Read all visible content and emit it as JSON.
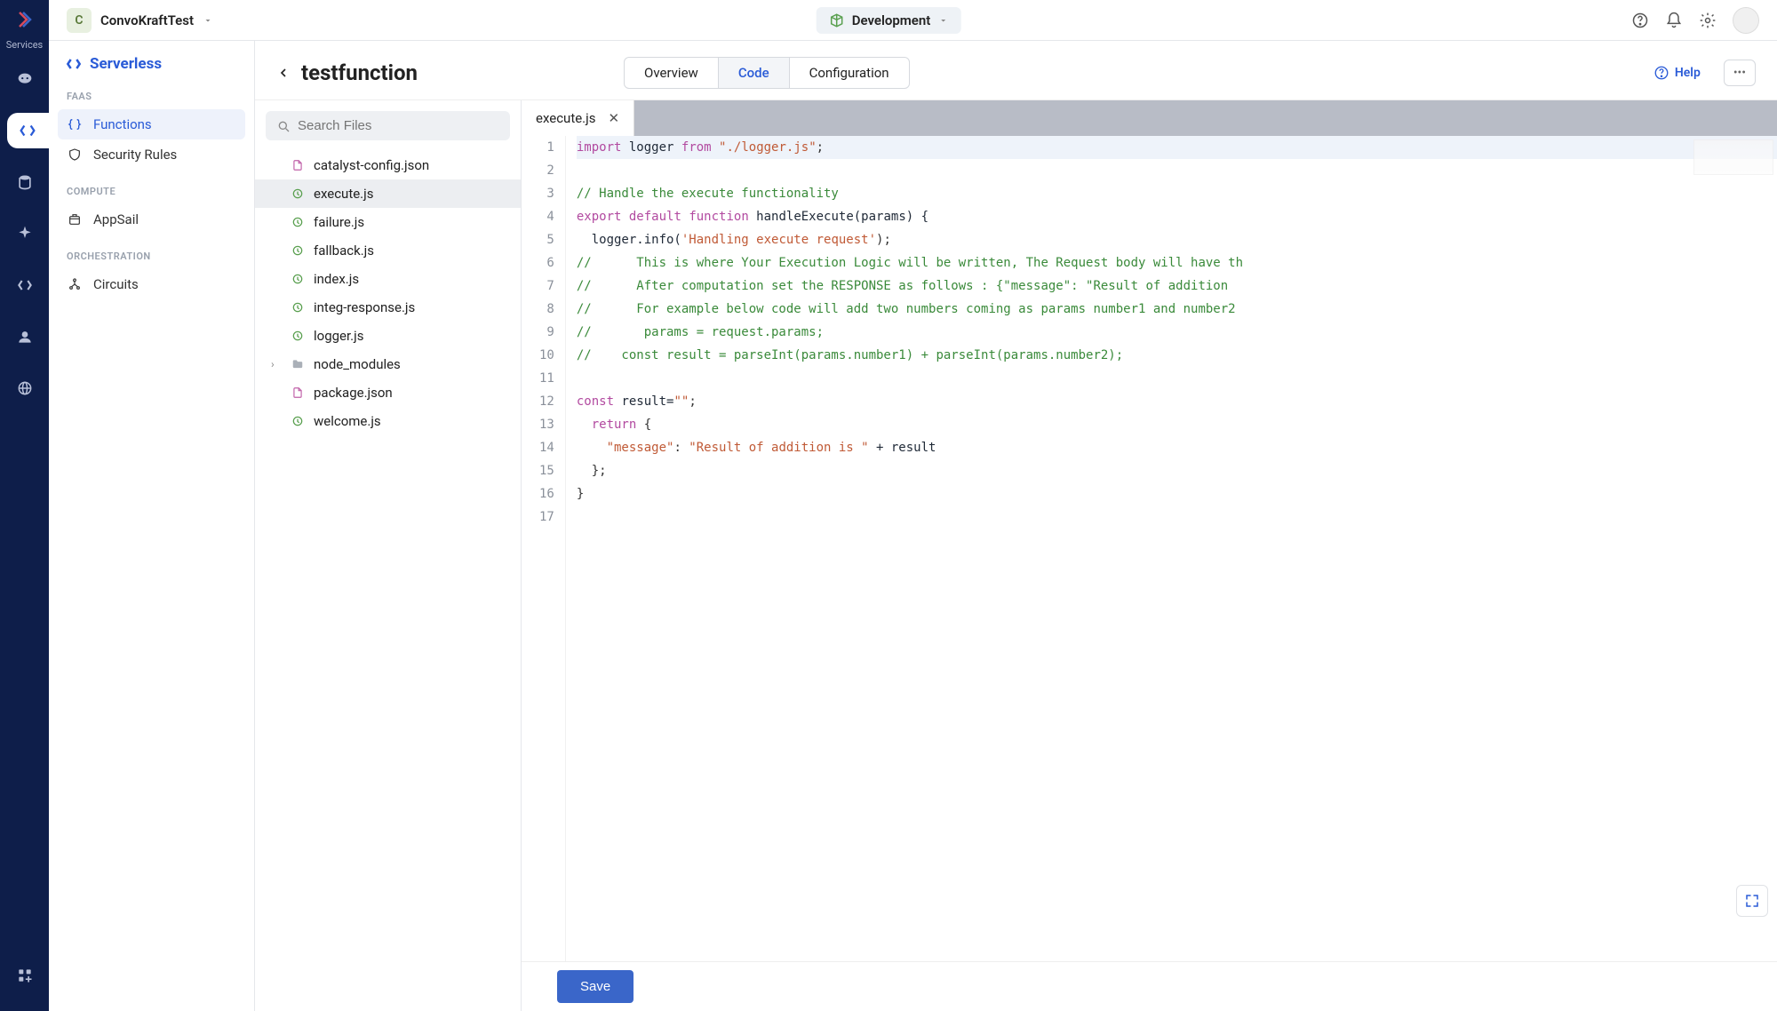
{
  "rail": {
    "label": "Services"
  },
  "topbar": {
    "project_initial": "C",
    "project_name": "ConvoKraftTest",
    "environment": "Development"
  },
  "sidebar": {
    "brand": "Serverless",
    "sections": [
      {
        "label": "FAAS",
        "items": [
          {
            "label": "Functions",
            "active": true,
            "icon": "braces"
          },
          {
            "label": "Security Rules",
            "active": false,
            "icon": "shield"
          }
        ]
      },
      {
        "label": "COMPUTE",
        "items": [
          {
            "label": "AppSail",
            "active": false,
            "icon": "sail"
          }
        ]
      },
      {
        "label": "ORCHESTRATION",
        "items": [
          {
            "label": "Circuits",
            "active": false,
            "icon": "circuits"
          }
        ]
      }
    ]
  },
  "header": {
    "title": "testfunction",
    "tabs": [
      "Overview",
      "Code",
      "Configuration"
    ],
    "active_tab": "Code",
    "help": "Help"
  },
  "files": {
    "search_placeholder": "Search Files",
    "items": [
      {
        "name": "catalyst-config.json",
        "type": "json"
      },
      {
        "name": "execute.js",
        "type": "js",
        "active": true
      },
      {
        "name": "failure.js",
        "type": "js"
      },
      {
        "name": "fallback.js",
        "type": "js"
      },
      {
        "name": "index.js",
        "type": "js"
      },
      {
        "name": "integ-response.js",
        "type": "js"
      },
      {
        "name": "logger.js",
        "type": "js"
      },
      {
        "name": "node_modules",
        "type": "folder",
        "expandable": true
      },
      {
        "name": "package.json",
        "type": "json"
      },
      {
        "name": "welcome.js",
        "type": "js"
      }
    ]
  },
  "editor": {
    "tab_name": "execute.js",
    "lines": [
      {
        "n": 1,
        "hl": true,
        "tokens": [
          {
            "t": "import ",
            "c": "tok-kw"
          },
          {
            "t": "logger ",
            "c": "tok-id"
          },
          {
            "t": "from ",
            "c": "tok-from"
          },
          {
            "t": "\"./logger.js\"",
            "c": "tok-str"
          },
          {
            "t": ";",
            "c": "tok-punc"
          }
        ]
      },
      {
        "n": 2,
        "tokens": []
      },
      {
        "n": 3,
        "tokens": [
          {
            "t": "// Handle the execute functionality",
            "c": "tok-cmt"
          }
        ]
      },
      {
        "n": 4,
        "tokens": [
          {
            "t": "export ",
            "c": "tok-kw"
          },
          {
            "t": "default ",
            "c": "tok-kw"
          },
          {
            "t": "function ",
            "c": "tok-kw"
          },
          {
            "t": "handleExecute(params) {",
            "c": "tok-fn"
          }
        ]
      },
      {
        "n": 5,
        "tokens": [
          {
            "t": "  logger.info(",
            "c": "tok-id"
          },
          {
            "t": "'Handling execute request'",
            "c": "tok-str"
          },
          {
            "t": ");",
            "c": "tok-punc"
          }
        ]
      },
      {
        "n": 6,
        "tokens": [
          {
            "t": "//      This is where Your Execution Logic will be written, The Request body will have th",
            "c": "tok-cmt"
          }
        ]
      },
      {
        "n": 7,
        "tokens": [
          {
            "t": "//      After computation set the RESPONSE as follows : {\"message\": \"Result of addition ",
            "c": "tok-cmt"
          }
        ]
      },
      {
        "n": 8,
        "tokens": [
          {
            "t": "//      For example below code will add two numbers coming as params number1 and number2",
            "c": "tok-cmt"
          }
        ]
      },
      {
        "n": 9,
        "tokens": [
          {
            "t": "//       params = request.params;",
            "c": "tok-cmt"
          }
        ]
      },
      {
        "n": 10,
        "tokens": [
          {
            "t": "//    const result = parseInt(params.number1) + parseInt(params.number2);",
            "c": "tok-cmt"
          }
        ]
      },
      {
        "n": 11,
        "tokens": []
      },
      {
        "n": 12,
        "tokens": [
          {
            "t": "const ",
            "c": "tok-kw"
          },
          {
            "t": "result=",
            "c": "tok-id"
          },
          {
            "t": "\"\"",
            "c": "tok-str"
          },
          {
            "t": ";",
            "c": "tok-punc"
          }
        ]
      },
      {
        "n": 13,
        "tokens": [
          {
            "t": "  return ",
            "c": "tok-kw"
          },
          {
            "t": "{",
            "c": "tok-punc"
          }
        ]
      },
      {
        "n": 14,
        "tokens": [
          {
            "t": "    \"message\"",
            "c": "tok-str"
          },
          {
            "t": ": ",
            "c": "tok-punc"
          },
          {
            "t": "\"Result of addition is \"",
            "c": "tok-str"
          },
          {
            "t": " + result",
            "c": "tok-id"
          }
        ]
      },
      {
        "n": 15,
        "tokens": [
          {
            "t": "  };",
            "c": "tok-punc"
          }
        ]
      },
      {
        "n": 16,
        "tokens": [
          {
            "t": "}",
            "c": "tok-punc"
          }
        ]
      },
      {
        "n": 17,
        "tokens": []
      }
    ]
  },
  "footer": {
    "save_label": "Save"
  }
}
